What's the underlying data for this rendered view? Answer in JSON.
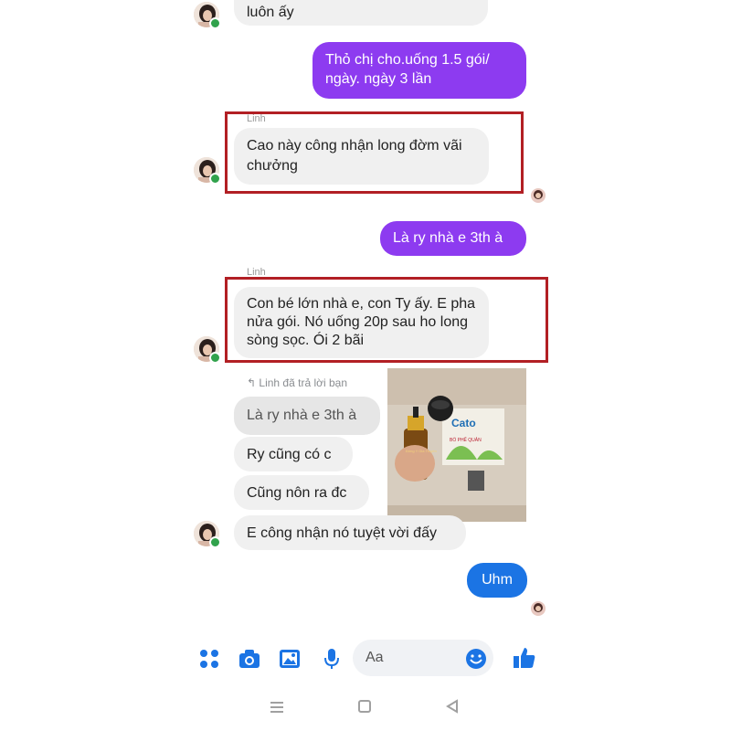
{
  "messages": {
    "m1_in": "luôn ấy",
    "m2_out": "Thỏ chị cho.uống 1.5 gói/ ngày. ngày 3 lần",
    "m3_sender": "Linh",
    "m3_in": "Cao này công nhận long đờm vãi chưởng",
    "m4_out": "Là ry nhà e 3th à",
    "m5_sender": "Linh",
    "m5_in": "Con bé lớn nhà e, con Ty ấy. E pha nửa gói. Nó uống 20p sau ho long sòng sọc. Ói 2 bãi",
    "reply_label": "Linh đã trả lời bạn",
    "m6_quoted": "Là ry nhà e 3th à",
    "m7_in": "Ry cũng có c",
    "m8_in": "Cũng nôn ra đc",
    "m9_in": "E công nhận nó tuyệt vời đấy",
    "m10_out": "Uhm"
  },
  "photo": {
    "product_brand": "Cato",
    "product_sub": "BỔ PHẾ QUẢN",
    "bottle_label": "Đông Y Gia Truyền"
  },
  "composer": {
    "placeholder": "Aa"
  },
  "colors": {
    "purple_bubble": "#8d3bf0",
    "blue_bubble": "#1b74e4",
    "incoming_bubble": "#f0f0f0",
    "highlight_box": "#b21f24",
    "toolbar_icon": "#1b74e4"
  },
  "icons": {
    "toolbar": [
      "menu-dots-icon",
      "camera-icon",
      "image-icon",
      "microphone-icon",
      "emoji-icon",
      "thumbs-up-icon"
    ],
    "navbar": [
      "recent-apps-icon",
      "home-icon",
      "back-icon"
    ]
  }
}
